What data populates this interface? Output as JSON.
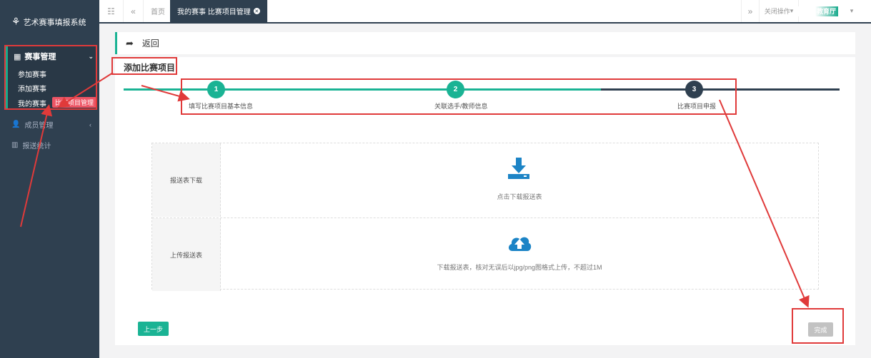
{
  "sidebar": {
    "brand": "艺术赛事填报系统",
    "groups": [
      {
        "label": "赛事管理",
        "items": [
          "参加赛事",
          "添加赛事",
          "我的赛事"
        ]
      },
      {
        "label": "成员管理"
      },
      {
        "label": "报送统计"
      }
    ],
    "tooltip": "比赛项目管理"
  },
  "topbar": {
    "tabs": [
      "首页",
      "我的赛事 比赛项目管理"
    ],
    "close_ops": "关闭操作",
    "user": "教育厅"
  },
  "page": {
    "back_label": "返回",
    "title": "添加比赛项目",
    "steps": [
      {
        "num": "1",
        "label": "填写比赛项目基本信息",
        "state": "done"
      },
      {
        "num": "2",
        "label": "关联选手/教师信息",
        "state": "done"
      },
      {
        "num": "3",
        "label": "比赛项目申报",
        "state": "current"
      }
    ],
    "download_row": {
      "label": "报送表下载",
      "hint": "点击下载报送表"
    },
    "upload_row": {
      "label": "上传报送表",
      "hint": "下载报送表，核对无误后以jpg/png图格式上传，不超过1M"
    },
    "prev_button": "上一步",
    "done_button": "完成"
  },
  "colors": {
    "accent": "#1ab394",
    "sidebar": "#2f4050",
    "annotation": "#e03a3a",
    "icon_blue": "#1c84c6"
  }
}
